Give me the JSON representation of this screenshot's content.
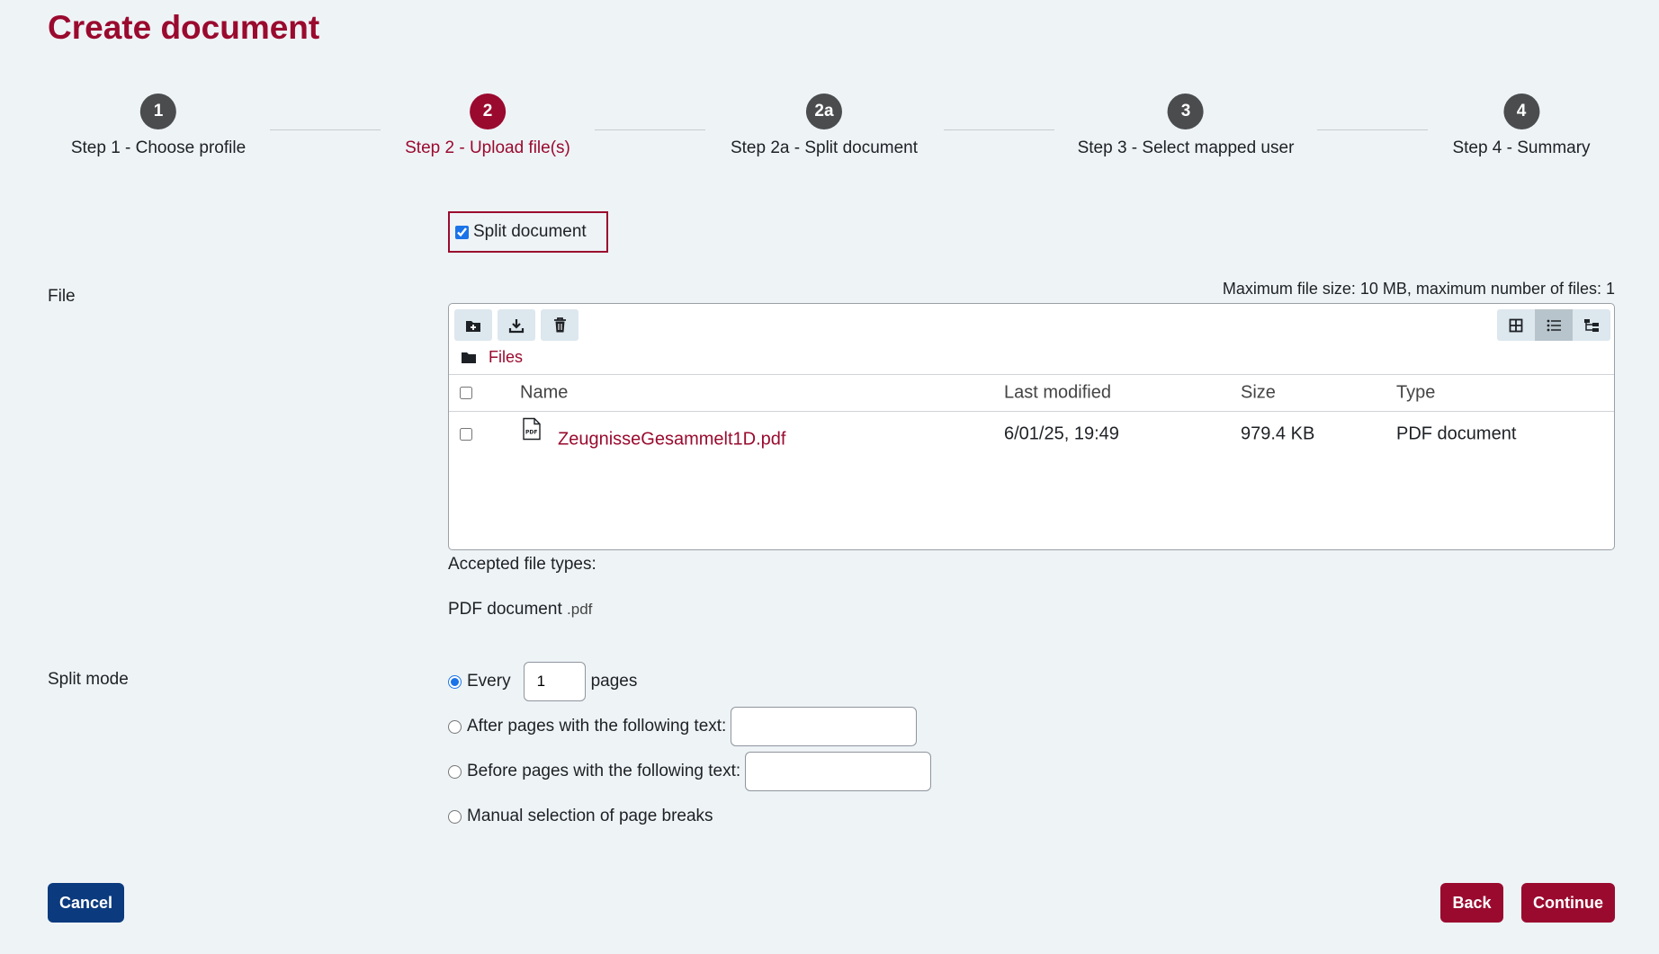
{
  "page": {
    "title": "Create document"
  },
  "stepper": {
    "steps": [
      {
        "number": "1",
        "label": "Step 1 - Choose profile",
        "active": false
      },
      {
        "number": "2",
        "label": "Step 2 - Upload file(s)",
        "active": true
      },
      {
        "number": "2a",
        "label": "Step 2a - Split document",
        "active": false
      },
      {
        "number": "3",
        "label": "Step 3 - Select mapped user",
        "active": false
      },
      {
        "number": "4",
        "label": "Step 4 - Summary",
        "active": false
      }
    ]
  },
  "split_document": {
    "label": "Split document",
    "checked": true
  },
  "file_section": {
    "label": "File",
    "limits": "Maximum file size: 10 MB, maximum number of files: 1",
    "toolbar": {
      "add_icon": "folder-plus-icon",
      "download_icon": "download-icon",
      "delete_icon": "trash-icon"
    },
    "views": {
      "grid_icon": "grid-view-icon",
      "list_icon": "list-view-icon",
      "tree_icon": "tree-view-icon",
      "selected": "list"
    },
    "path": {
      "icon": "folder-icon",
      "label": "Files"
    },
    "table": {
      "columns": [
        "Name",
        "Last modified",
        "Size",
        "Type"
      ],
      "rows": [
        {
          "name": "ZeugnisseGesammelt1D.pdf",
          "modified": "6/01/25, 19:49",
          "size": "979.4 KB",
          "type": "PDF document",
          "icon": "pdf-file-icon"
        }
      ]
    },
    "accepted_label": "Accepted file types:",
    "accepted_type": "PDF document",
    "accepted_ext": ".pdf"
  },
  "split_mode": {
    "label": "Split mode",
    "options": [
      {
        "label": "Every",
        "suffix": "pages",
        "value": "1",
        "checked": true
      },
      {
        "label": "After pages with the following text:",
        "value": "",
        "checked": false
      },
      {
        "label": "Before pages with the following text:",
        "value": "",
        "checked": false
      },
      {
        "label": "Manual selection of page breaks",
        "checked": false
      }
    ]
  },
  "actions": {
    "cancel": "Cancel",
    "back": "Back",
    "continue": "Continue"
  },
  "colors": {
    "brand": "#9a0a2e",
    "cancel": "#0b3a7e",
    "step_inactive": "#4a4c4e",
    "background": "#eef3f6"
  }
}
